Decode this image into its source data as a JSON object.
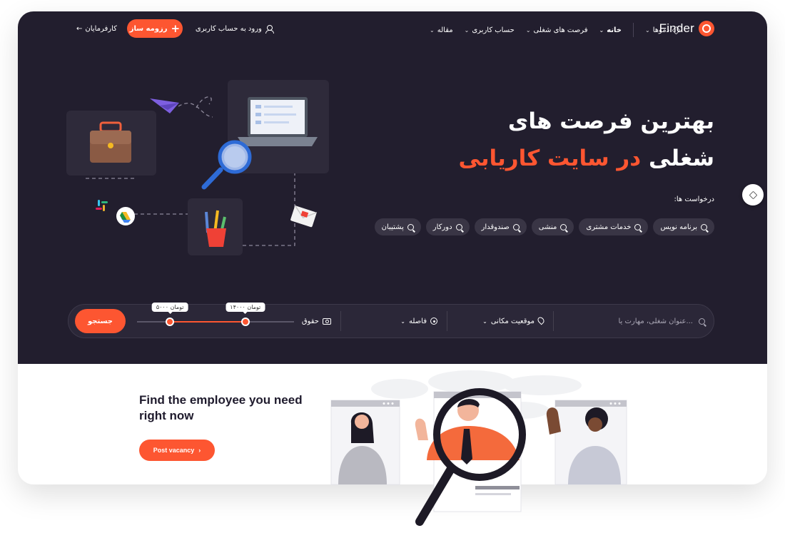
{
  "nav": {
    "logo_text": "Finder",
    "menu": [
      "دموها",
      "خانه",
      "فرصت های شغلی",
      "حساب کاربری",
      "مقاله"
    ],
    "login_label": "ورود به حساب کاربری",
    "resume_button": "رزومه ساز",
    "employers_link": "کارفرمایان"
  },
  "hero": {
    "title_line1": "بهترین فرصت های",
    "title_line2_white": "شغلی",
    "title_line2_accent": "در سایت کاریابی",
    "requests_label": "درخواست ها:",
    "tags": [
      "برنامه نویس",
      "خدمات مشتری",
      "منشی",
      "صندوقدار",
      "دورکار",
      "پشتیبان"
    ]
  },
  "search": {
    "placeholder": "عنوان شغلی، مهارت یا...",
    "location_label": "موقعیت مکانی",
    "distance_label": "فاصله",
    "salary_label": "حقوق",
    "salary_min_label": "۵۰۰۰ تومان",
    "salary_max_label": "۱۴۰۰۰ تومان",
    "salary_min_fraction": 0.21,
    "salary_max_fraction": 0.69,
    "button_label": "جستجو"
  },
  "employers_section": {
    "title": "Find the employee you need right now",
    "button_label": "Post vacancy"
  },
  "colors": {
    "accent": "#fd5631",
    "hero_bg": "#221e2e"
  }
}
